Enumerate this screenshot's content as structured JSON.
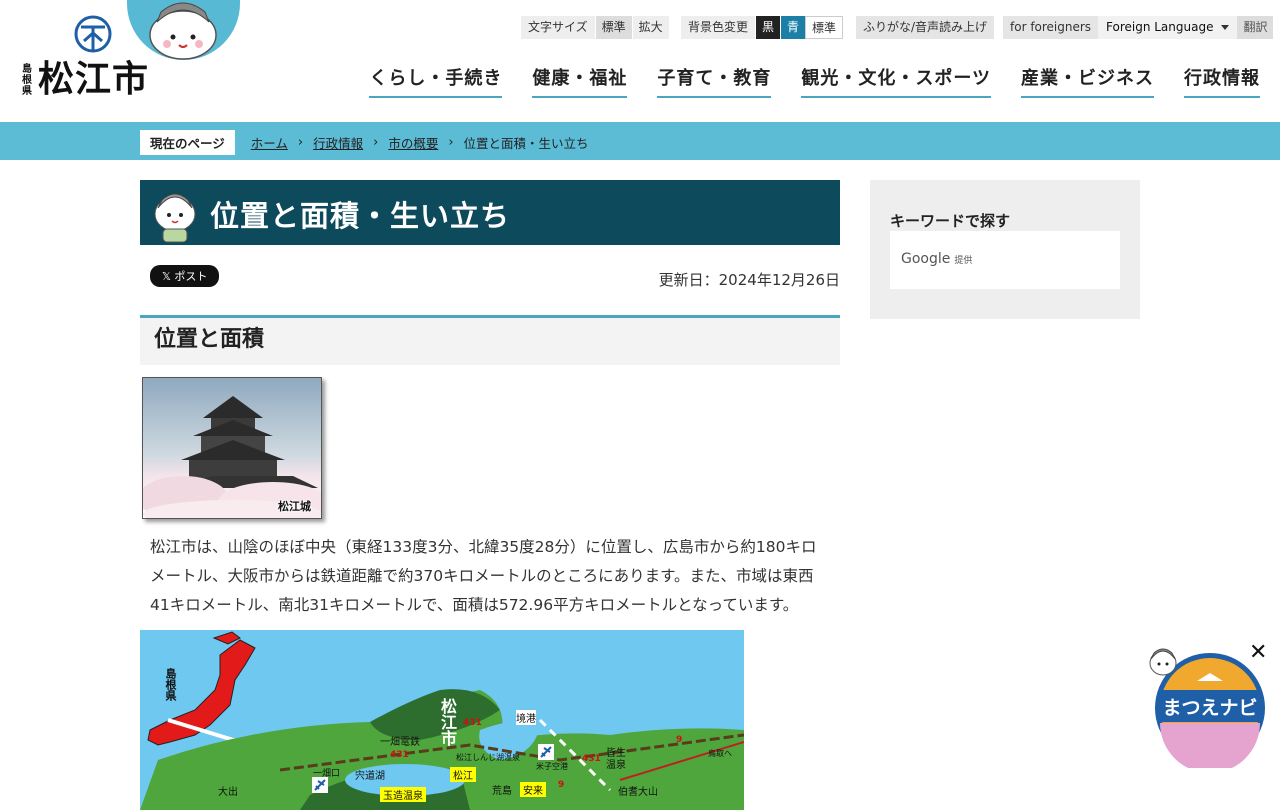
{
  "header": {
    "pref": "島根県",
    "city": "松江市",
    "text_size": {
      "label": "文字サイズ",
      "options": [
        "標準",
        "拡大"
      ]
    },
    "bg_color": {
      "label": "背景色変更",
      "options": [
        "黒",
        "青",
        "標準"
      ]
    },
    "furigana": "ふりがな/音声読み上げ",
    "foreigners": "for foreigners",
    "foreign_language": "Foreign Language",
    "translate": "翻訳",
    "nav": [
      "くらし・手続き",
      "健康・福祉",
      "子育て・教育",
      "観光・文化・スポーツ",
      "産業・ビジネス",
      "行政情報"
    ]
  },
  "breadcrumb": {
    "label": "現在のページ",
    "links": [
      "ホーム",
      "行政情報",
      "市の概要"
    ],
    "current": "位置と面積・生い立ち"
  },
  "main": {
    "title": "位置と面積・生い立ち",
    "post_button": "𝕏 ポスト",
    "updated": "更新日：2024年12月26日",
    "section_heading": "位置と面積",
    "castle_caption": "松江城",
    "paragraph": "松江市は、山陰のほぼ中央（東経133度3分、北緯35度28分）に位置し、広島市から約180キロメートル、大阪市からは鉄道距離で約370キロメートルのところにあります。また、市域は東西41キロメートル、南北31キロメートルで、面積は572.96平方キロメートルとなっています。",
    "map": {
      "pref_label": "島根県",
      "city_label": "松江市",
      "places": [
        "境港",
        "一畑電鉄",
        "宍道湖",
        "松江しんじ湖温泉",
        "米子空港",
        "皆生温泉",
        "一畑口",
        "松江",
        "玉造温泉",
        "荒島",
        "安来",
        "大出",
        "伯耆大山",
        "鳥取へ"
      ],
      "routes": [
        "431",
        "431",
        "431",
        "9",
        "9"
      ]
    }
  },
  "sidebar": {
    "search_title": "キーワードで探す",
    "google": "Google",
    "google_suffix": "提供"
  },
  "navi": {
    "label": "まつえナビ",
    "close": "✕"
  }
}
